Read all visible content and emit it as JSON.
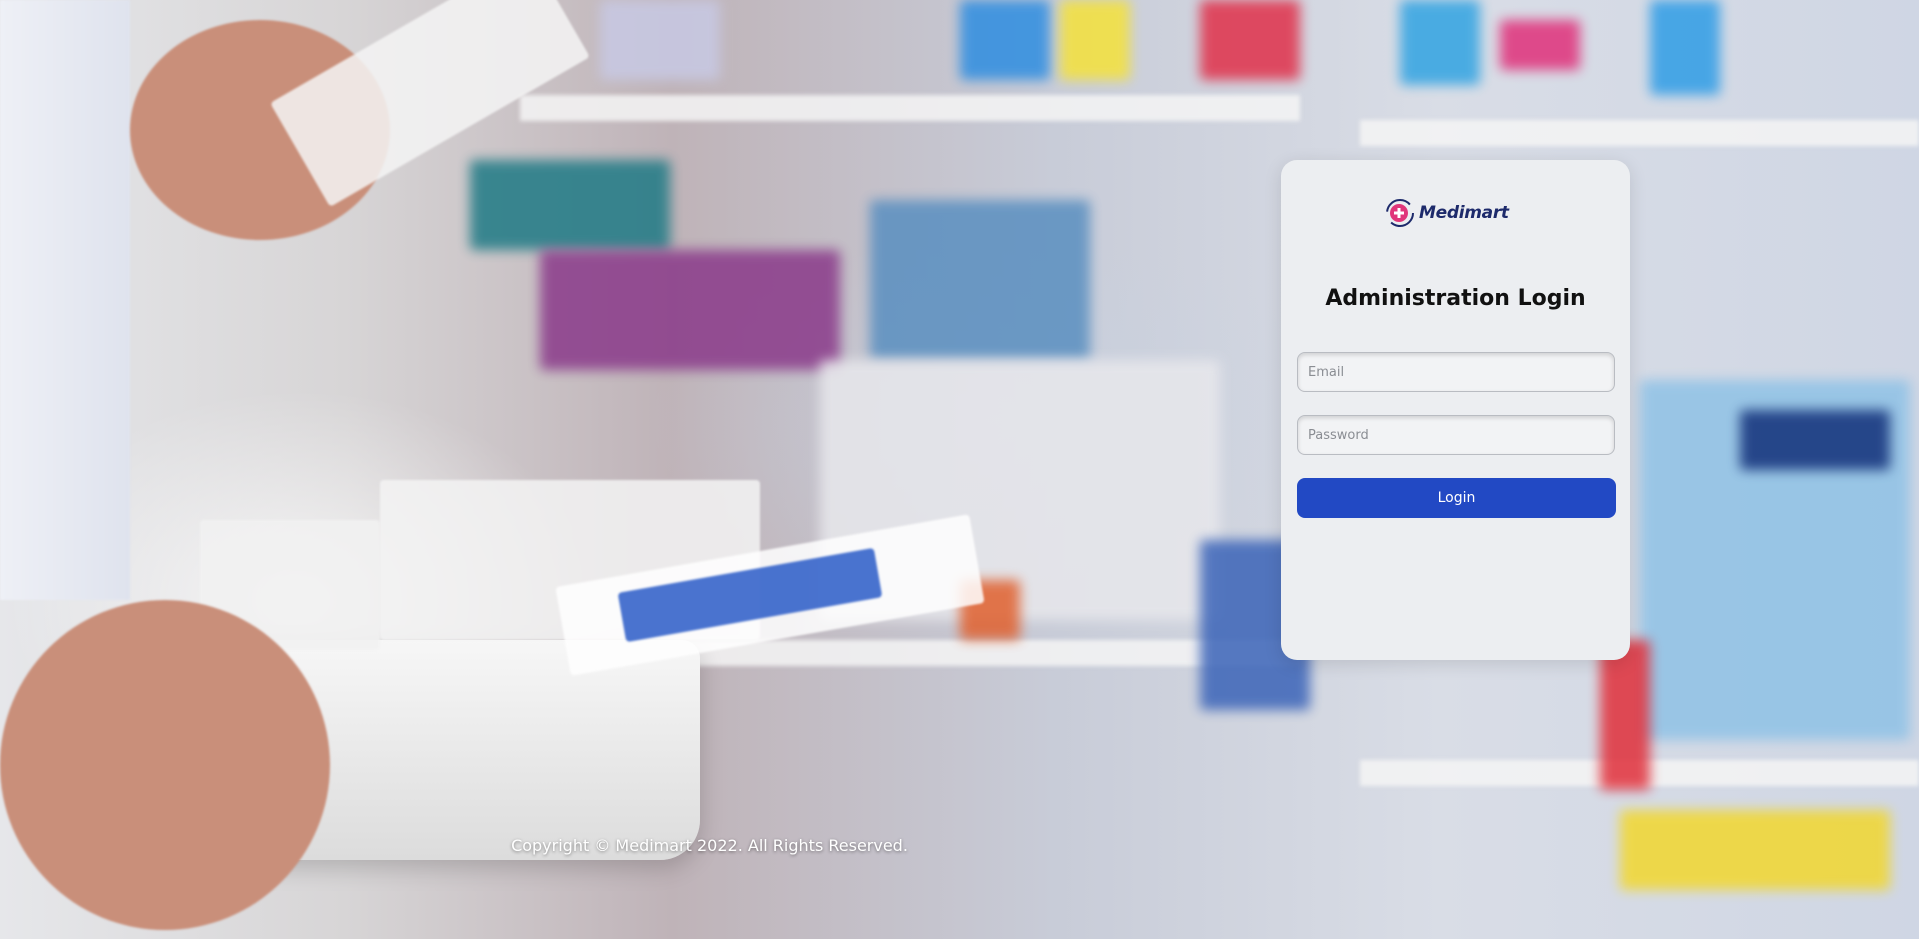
{
  "brand": {
    "name": "Medimart",
    "logo_icon": "medimart-cross-swoosh-icon",
    "primary_color": "#2249c4",
    "logo_text_color": "#1d2a6b",
    "logo_accent_color": "#e0357a"
  },
  "login": {
    "title": "Administration Login",
    "email_placeholder": "Email",
    "email_value": "",
    "password_placeholder": "Password",
    "password_value": "",
    "submit_label": "Login"
  },
  "footer": {
    "copyright": "Copyright © Medimart 2022. All Rights Reserved."
  },
  "background": {
    "image": "pharmacy-shelves-photo"
  }
}
